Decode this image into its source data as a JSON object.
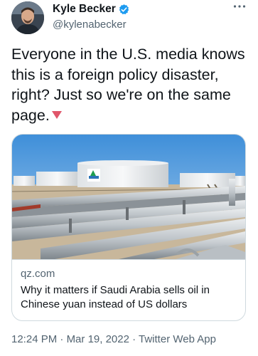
{
  "author": {
    "display_name": "Kyle Becker",
    "handle": "@kylenabecker",
    "verified": true,
    "avatar_icon": "person-avatar-icon",
    "verified_icon": "verified-badge-icon"
  },
  "more_icon": "more-options-icon",
  "tweet": {
    "text": "Everyone in the U.S. media knows this is a foreign policy disaster, right? Just so we're on the same page.",
    "emoji_icon": "red-triangle-down-icon"
  },
  "card": {
    "image_icon": "oil-storage-tanks-and-pipelines-photo",
    "domain": "qz.com",
    "title": "Why it matters if Saudi Arabia sells oil in Chinese yuan instead of US dollars"
  },
  "meta": {
    "time": "12:24 PM",
    "separator": " · ",
    "date": "Mar 19, 2022",
    "source": "Twitter Web App"
  },
  "colors": {
    "verified": "#1d9bf0",
    "secondary_text": "#536471",
    "border": "#cfd9de",
    "emoji": "#e0566a"
  }
}
